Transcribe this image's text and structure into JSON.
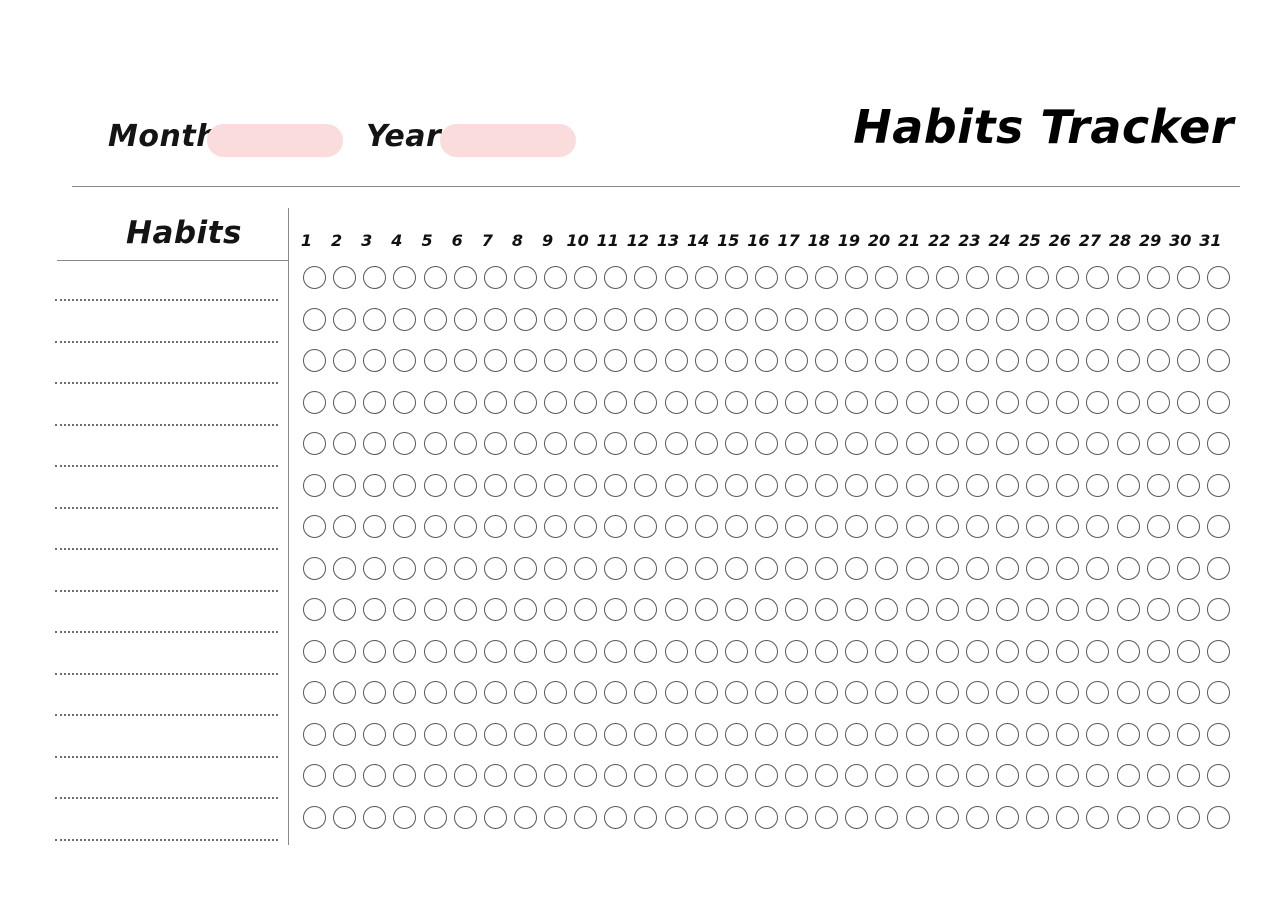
{
  "header": {
    "month_label": "Month",
    "year_label": "Year",
    "month_value": "",
    "year_value": "",
    "title": "Habits Tracker",
    "accent_color": "#fbdcdc",
    "rule_color": "#868686"
  },
  "table": {
    "habits_column_heading": "Habits",
    "divider_color": "#8a8a8a",
    "day_numbers": [
      "1",
      "2",
      "3",
      "4",
      "5",
      "6",
      "7",
      "8",
      "9",
      "10",
      "11",
      "12",
      "13",
      "14",
      "15",
      "16",
      "17",
      "18",
      "19",
      "20",
      "21",
      "22",
      "23",
      "24",
      "25",
      "26",
      "27",
      "28",
      "29",
      "30",
      "31"
    ],
    "habit_rows": [
      {
        "name": ""
      },
      {
        "name": ""
      },
      {
        "name": ""
      },
      {
        "name": ""
      },
      {
        "name": ""
      },
      {
        "name": ""
      },
      {
        "name": ""
      },
      {
        "name": ""
      },
      {
        "name": ""
      },
      {
        "name": ""
      },
      {
        "name": ""
      },
      {
        "name": ""
      },
      {
        "name": ""
      },
      {
        "name": ""
      }
    ],
    "row_count": 14,
    "columns_per_row": 31,
    "circle_state": "empty",
    "circle_color": "#57575e",
    "line_color": "#6d6d7a"
  }
}
